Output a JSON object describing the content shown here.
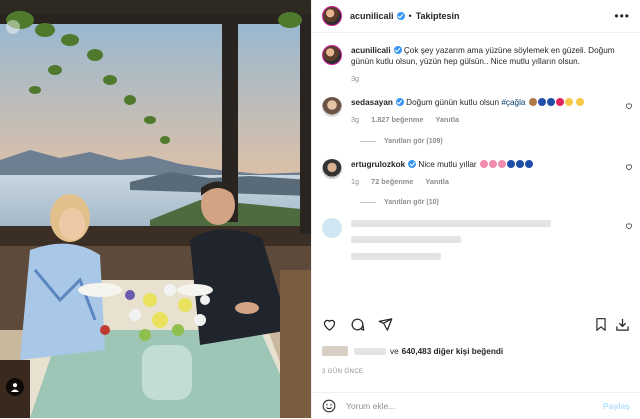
{
  "header": {
    "username": "acunilicali",
    "separator": "•",
    "follow_status": "Takiptesin",
    "more": "•••"
  },
  "caption": {
    "username": "acunilicali",
    "text": "Çok şey yazarım ama yüzüne söylemek en güzeli. Doğum günün kutlu olsun, yüzün hep gülsün.. Nice mutlu yılların olsun.",
    "time": "3g"
  },
  "comments": [
    {
      "username": "sedasayan",
      "text": "Doğum günün kutlu olsun",
      "hashtag": "#çağla",
      "time": "3g",
      "likes": "1.827 beğenme",
      "reply": "Yanıtla",
      "view_replies": "Yanıtları gör (109)"
    },
    {
      "username": "ertugrulozkok",
      "text": "Nice mutlu yıllar",
      "time": "1g",
      "likes": "72 beğenme",
      "reply": "Yanıtla",
      "view_replies": "Yanıtları gör (10)"
    }
  ],
  "likes": {
    "prefix": "ve",
    "count_text": "640,483 diğer kişi beğendi"
  },
  "timestamp": "3 GÜN ÖNCE",
  "add_comment": {
    "placeholder": "Yorum ekle...",
    "post_label": "Paylaş"
  },
  "icons": [
    "heart-icon",
    "comment-icon",
    "share-icon",
    "bookmark-icon",
    "download-icon",
    "emoji-icon",
    "more-icon",
    "user-tag-icon"
  ],
  "colors": {
    "verified": "#3897f0",
    "hashtag": "#00376b",
    "muted": "#8e8e8e",
    "post_button": "#b2dffc"
  }
}
